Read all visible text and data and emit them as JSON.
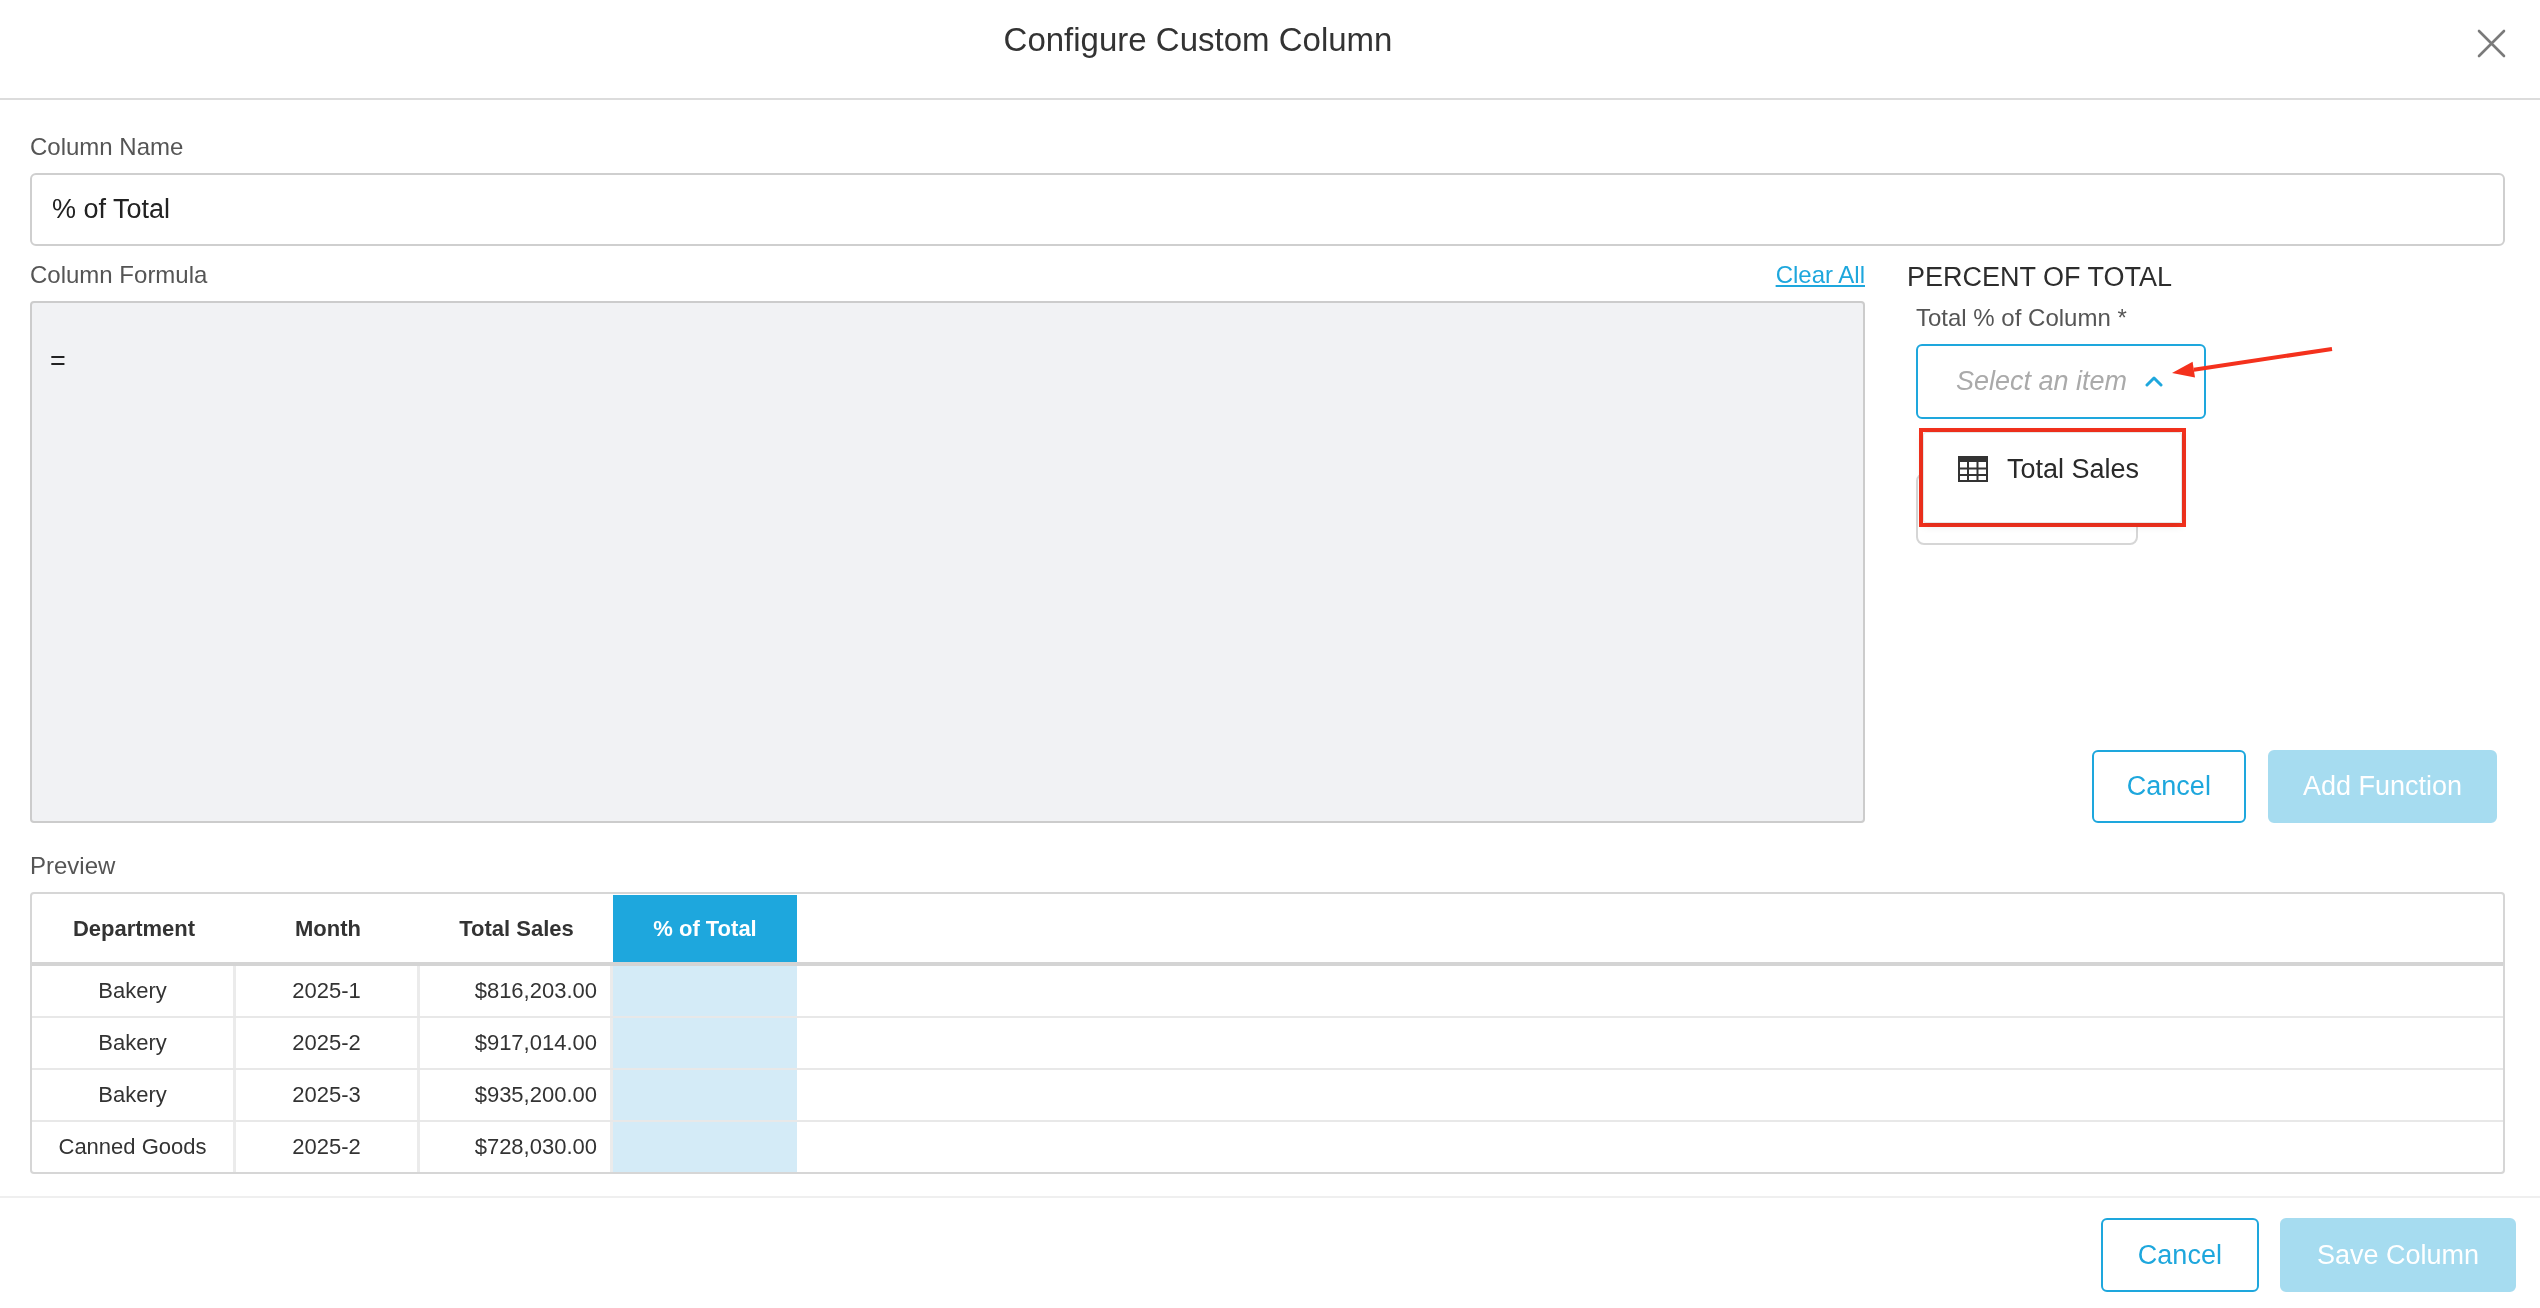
{
  "dialog": {
    "title": "Configure Custom Column"
  },
  "column_name": {
    "label": "Column Name",
    "value": "% of Total"
  },
  "column_formula": {
    "label": "Column Formula",
    "clear_link": "Clear All",
    "value": "="
  },
  "function_panel": {
    "heading": "PERCENT OF TOTAL",
    "field_label": "Total % of Column *",
    "dropdown": {
      "placeholder": "Select an item",
      "expanded": true,
      "options": [
        {
          "label": "Total Sales",
          "selected": false
        }
      ]
    },
    "buttons": [
      {
        "label": "Cancel",
        "kind": "outline",
        "disabled": false
      },
      {
        "label": "Add Function",
        "kind": "primary",
        "disabled": true
      }
    ]
  },
  "annotations": {
    "arrow_to_caret": true,
    "frame_around_menu": true
  },
  "preview": {
    "label": "Preview",
    "columns": [
      {
        "label": "Department",
        "kind": "text",
        "highlighted": false
      },
      {
        "label": "Month",
        "kind": "text",
        "highlighted": false
      },
      {
        "label": "Total Sales",
        "kind": "currency",
        "highlighted": false
      },
      {
        "label": "% of Total",
        "kind": "text",
        "highlighted": true
      }
    ],
    "rows": [
      [
        "Bakery",
        "2025-1",
        "$816,203.00"
      ],
      [
        "Bakery",
        "2025-2",
        "$917,014.00"
      ],
      [
        "Bakery",
        "2025-3",
        "$935,200.00"
      ],
      [
        "Canned Goods",
        "2025-2",
        "$728,030.00"
      ]
    ]
  },
  "footer": {
    "buttons": [
      {
        "label": "Cancel",
        "kind": "outline",
        "disabled": false
      },
      {
        "label": "Save Column",
        "kind": "primary",
        "disabled": true
      }
    ]
  }
}
